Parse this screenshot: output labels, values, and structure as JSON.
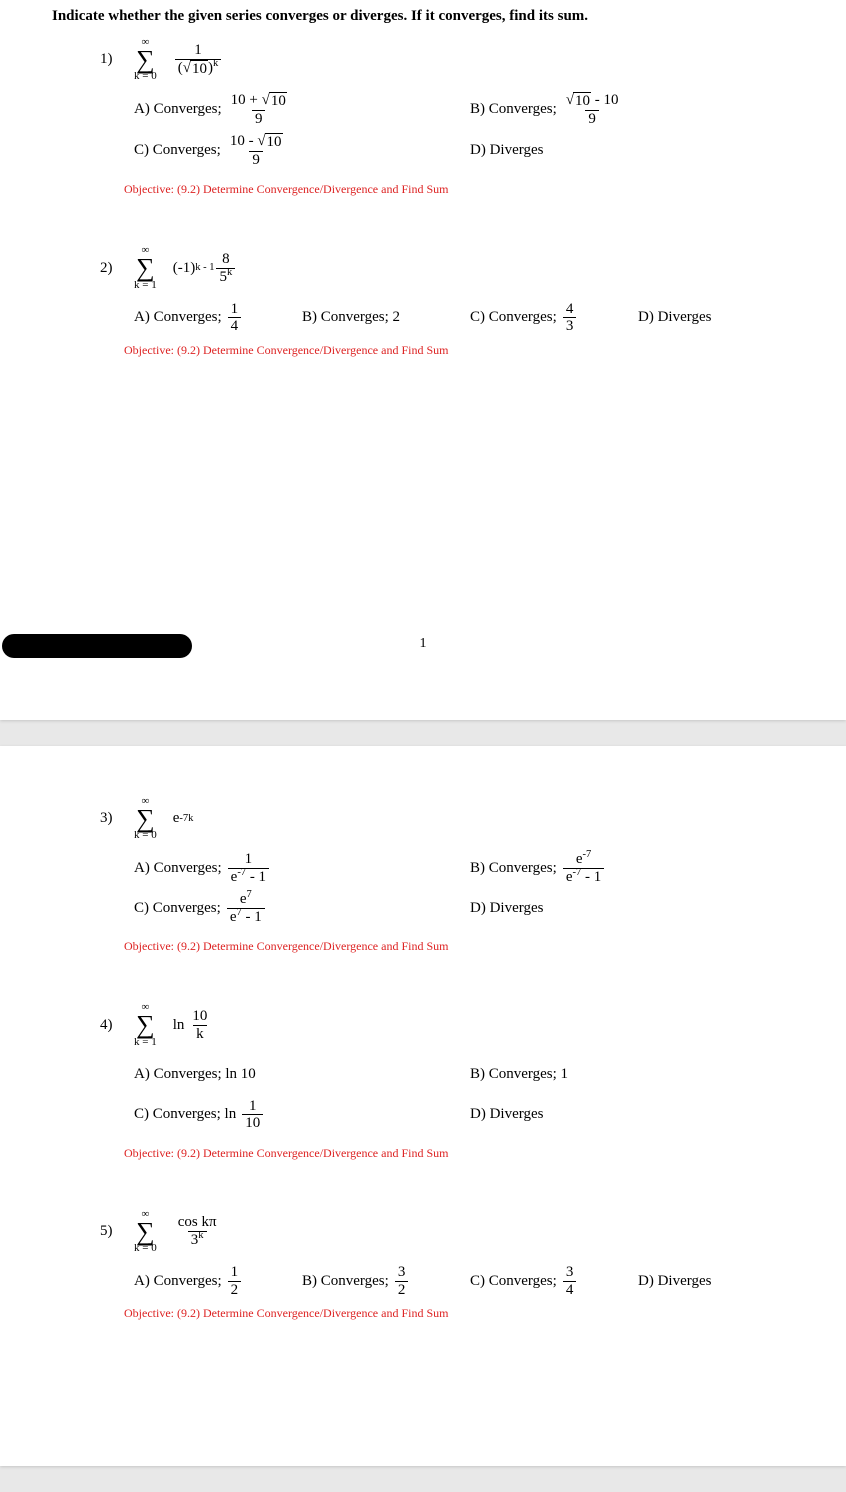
{
  "instructions": "Indicate whether the given series converges or diverges. If it converges, find its sum.",
  "pageNumber": "1",
  "objectiveText": "Objective:  (9.2) Determine Convergence/Divergence and Find Sum",
  "problems": {
    "p1": {
      "num": "1)",
      "sumTop": "∞",
      "sumBot": "k = 0",
      "exprNum": "1",
      "exprDenBase": "10",
      "exprDenExp": "k",
      "A": "A) Converges;",
      "Anum1": "10 + ",
      "Anum2": "10",
      "Aden": "9",
      "B": "B) Converges;",
      "Bnum1": "10",
      "Bnum2": " - 10",
      "Bden": "9",
      "C": "C) Converges;",
      "Cnum1": "10 - ",
      "Cnum2": "10",
      "Cden": "9",
      "D": "D) Diverges"
    },
    "p2": {
      "num": "2)",
      "sumTop": "∞",
      "sumBot": "k = 1",
      "exprBase": "(-1)",
      "exprExp": "k - 1",
      "exprNum": "8",
      "exprDenBase": "5",
      "exprDenExp": "k",
      "A": "A) Converges;",
      "Anum": "1",
      "Aden": "4",
      "B": "B) Converges; 2",
      "C": "C) Converges;",
      "Cnum": "4",
      "Cden": "3",
      "D": "D) Diverges"
    },
    "p3": {
      "num": "3)",
      "sumTop": "∞",
      "sumBot": "k = 0",
      "exprBase": "e",
      "exprExp": "-7k",
      "A": "A) Converges;",
      "Anum": "1",
      "AdenBase": "e",
      "AdenExp": "-7",
      "AdenTail": " - 1",
      "B": "B) Converges;",
      "BnumBase": "e",
      "BnumExp": "-7",
      "BdenBase": "e",
      "BdenExp": "-7",
      "BdenTail": " - 1",
      "C": "C) Converges;",
      "CnumBase": "e",
      "CnumExp": "7",
      "CdenBase": "e",
      "CdenExp": "7",
      "CdenTail": " - 1",
      "D": "D) Diverges"
    },
    "p4": {
      "num": "4)",
      "sumTop": "∞",
      "sumBot": "k = 1",
      "exprLn": "ln",
      "exprNum": "10",
      "exprDen": "k",
      "A": "A) Converges; ln 10",
      "B": "B) Converges; 1",
      "C": "C) Converges; ln",
      "Cnum": "1",
      "Cden": "10",
      "D": "D) Diverges"
    },
    "p5": {
      "num": "5)",
      "sumTop": "∞",
      "sumBot": "k = 0",
      "exprNum": "cos kπ",
      "exprDenBase": "3",
      "exprDenExp": "k",
      "A": "A) Converges;",
      "Anum": "1",
      "Aden": "2",
      "B": "B) Converges;",
      "Bnum": "3",
      "Bden": "2",
      "C": "C) Converges;",
      "Cnum": "3",
      "Cden": "4",
      "D": "D) Diverges"
    }
  }
}
